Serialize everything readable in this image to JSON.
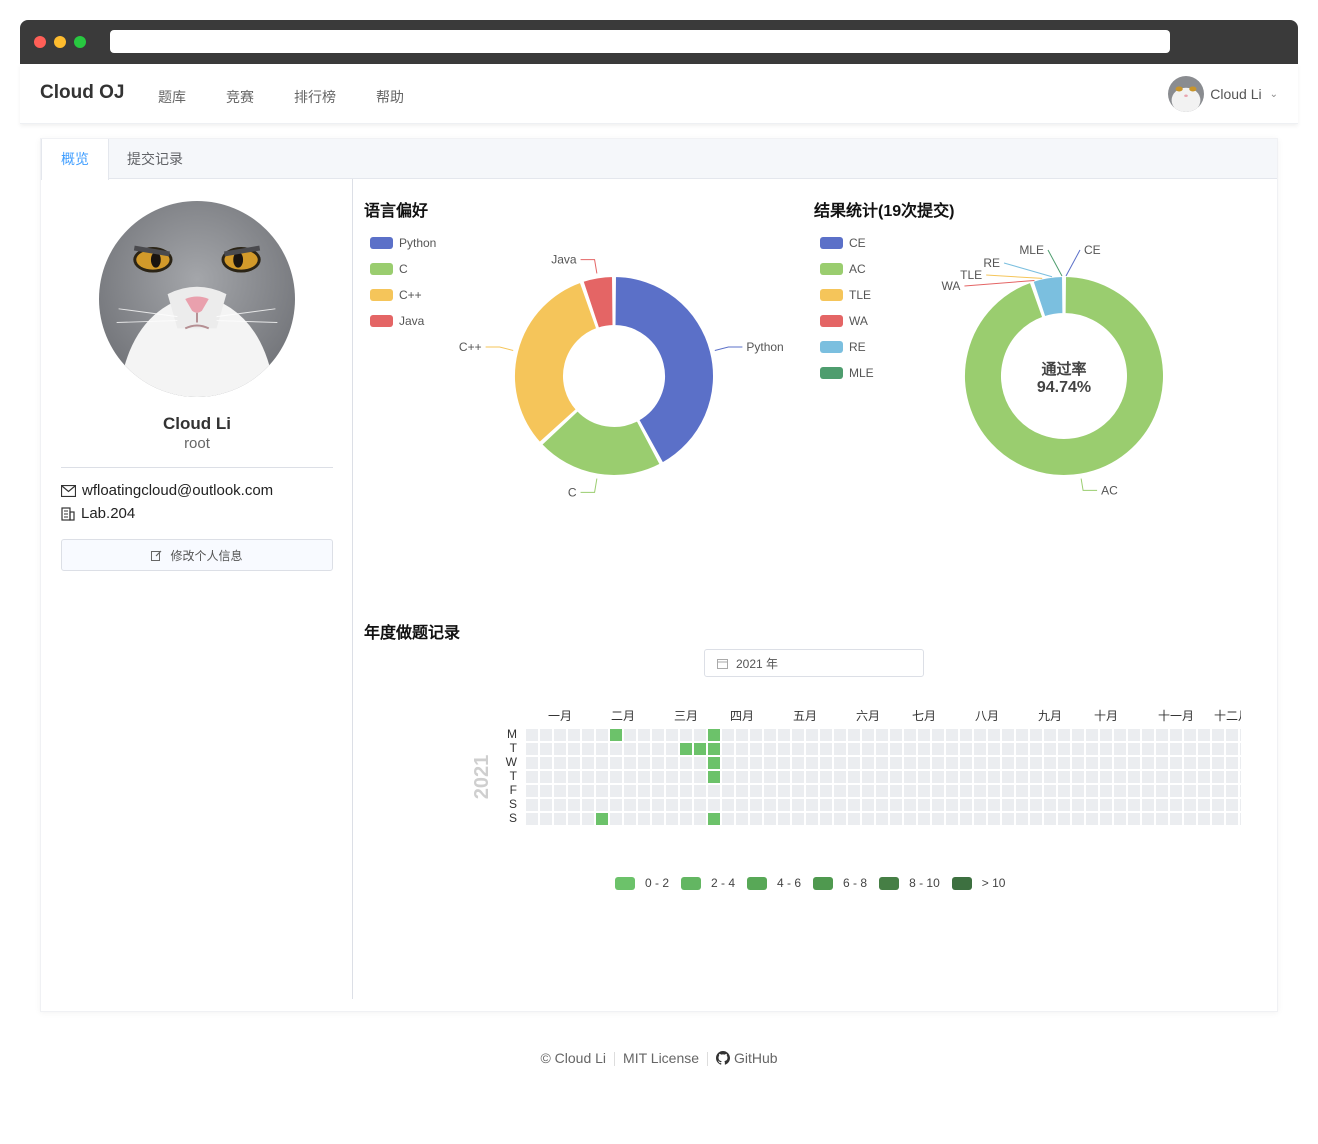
{
  "navbar": {
    "brand": "Cloud OJ",
    "items": [
      "题库",
      "竞赛",
      "排行榜",
      "帮助"
    ],
    "user_name": "Cloud Li"
  },
  "tabs": [
    "概览",
    "提交记录"
  ],
  "profile": {
    "name": "Cloud Li",
    "username": "root",
    "email": "wfloatingcloud@outlook.com",
    "org": "Lab.204",
    "edit_label": "修改个人信息"
  },
  "language_chart": {
    "title": "语言偏好",
    "legend": [
      {
        "name": "Python",
        "color": "#5b70c8"
      },
      {
        "name": "C",
        "color": "#9acd6f"
      },
      {
        "name": "C++",
        "color": "#f5c55a"
      },
      {
        "name": "Java",
        "color": "#e46565"
      }
    ]
  },
  "result_chart": {
    "title": "结果统计(19次提交)",
    "center_label": "通过率",
    "center_value": "94.74%",
    "legend": [
      {
        "name": "CE",
        "color": "#5b70c8"
      },
      {
        "name": "AC",
        "color": "#9acd6f"
      },
      {
        "name": "TLE",
        "color": "#f5c55a"
      },
      {
        "name": "WA",
        "color": "#e46565"
      },
      {
        "name": "RE",
        "color": "#7bbfdf"
      },
      {
        "name": "MLE",
        "color": "#4e9d6e"
      }
    ]
  },
  "heatmap": {
    "title": "年度做题记录",
    "year_picker": "2021 年",
    "year_label": "2021",
    "months": [
      "一月",
      "二月",
      "三月",
      "四月",
      "五月",
      "六月",
      "七月",
      "八月",
      "九月",
      "十月",
      "十一月",
      "十二月"
    ],
    "weekdays": [
      "M",
      "T",
      "W",
      "T",
      "F",
      "S",
      "S"
    ],
    "legend": [
      "0 - 2",
      "2 - 4",
      "4 - 6",
      "6 - 8",
      "8 - 10",
      "> 10"
    ],
    "legend_colors": [
      "#6cc26a",
      "#63b662",
      "#58a857",
      "#4f994f",
      "#467f45",
      "#3d7040"
    ]
  },
  "chart_data": [
    {
      "type": "pie",
      "title": "语言偏好",
      "categories": [
        "Python",
        "C",
        "C++",
        "Java"
      ],
      "values": [
        8,
        4,
        6,
        1
      ]
    },
    {
      "type": "pie",
      "title": "结果统计(19次提交)",
      "categories": [
        "CE",
        "AC",
        "TLE",
        "WA",
        "RE",
        "MLE"
      ],
      "values": [
        0,
        18,
        0,
        0,
        1,
        0
      ]
    },
    {
      "type": "heatmap",
      "title": "年度做题记录",
      "active_cells": [
        {
          "week": 6,
          "day": 0
        },
        {
          "week": 13,
          "day": 0
        },
        {
          "week": 11,
          "day": 1
        },
        {
          "week": 12,
          "day": 1
        },
        {
          "week": 13,
          "day": 1
        },
        {
          "week": 13,
          "day": 2
        },
        {
          "week": 13,
          "day": 3
        },
        {
          "week": 5,
          "day": 6
        },
        {
          "week": 13,
          "day": 6
        }
      ]
    }
  ],
  "footer": {
    "copyright": "© Cloud Li",
    "license": "MIT License",
    "github": "GitHub"
  }
}
